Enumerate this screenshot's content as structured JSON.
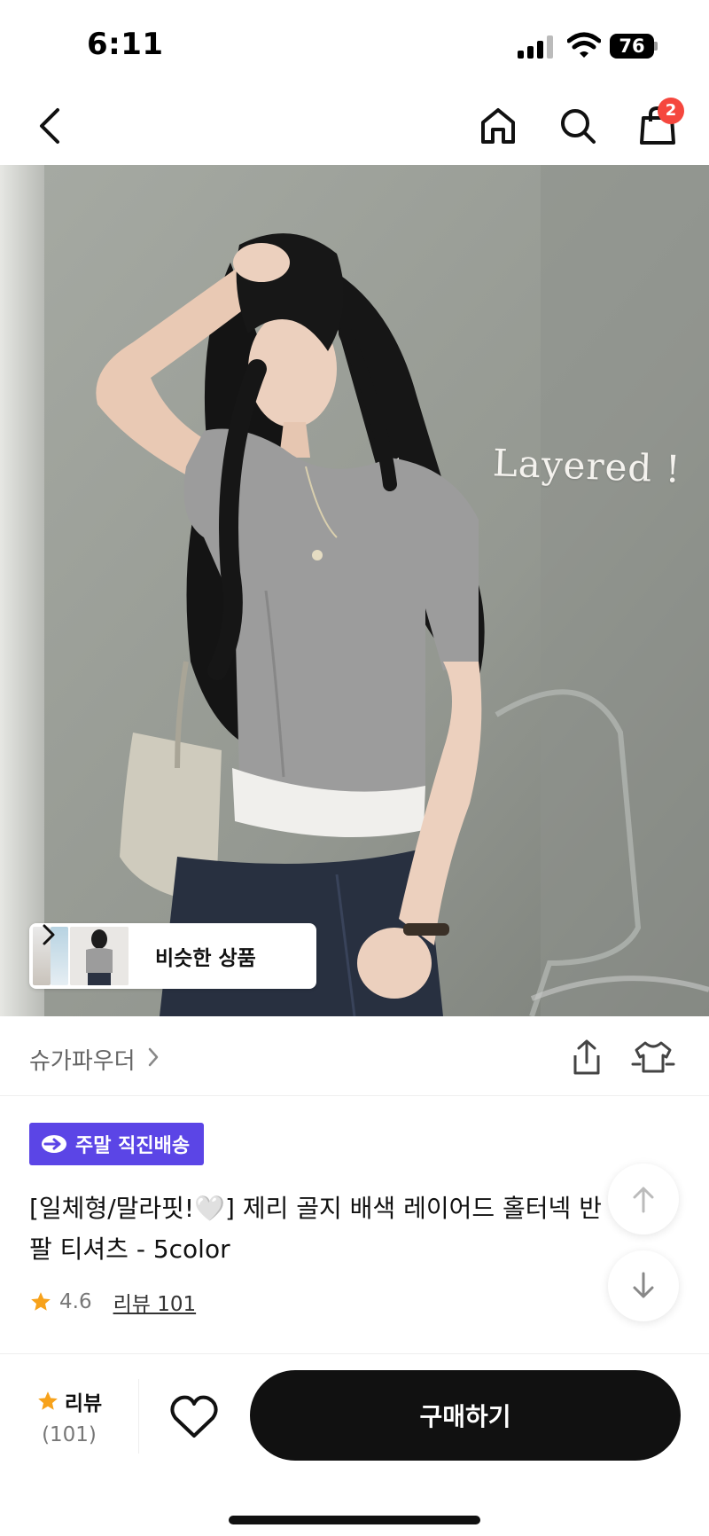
{
  "status_bar": {
    "time": "6:11",
    "battery_level": "76",
    "icons": [
      "cellular-signal-icon",
      "wifi-icon",
      "battery-icon"
    ]
  },
  "nav": {
    "cart_count": "2",
    "icons": [
      "back-arrow-icon",
      "home-icon",
      "search-icon",
      "shopping-bag-icon"
    ]
  },
  "hero": {
    "overlay_text": "Layered !",
    "similar_products_label": "비슷한 상품"
  },
  "seller": {
    "name": "슈가파우더",
    "icons": [
      "chevron-right-icon",
      "share-icon",
      "fitting-icon"
    ]
  },
  "product": {
    "badge": "주말 직진배송",
    "title": "[일체형/말라핏!🤍] 제리 골지 배색 레이어드 홀터넥 반팔 티셔츠 - 5color",
    "rating": "4.6",
    "review_link": "리뷰 101"
  },
  "bottom_bar": {
    "review_label": "리뷰",
    "review_count": "(101)",
    "buy_label": "구매하기"
  },
  "colors": {
    "badge_bg": "#5b45e6",
    "cart_badge": "#f5473e",
    "star": "#f7a21b",
    "buy_button": "#111111"
  }
}
